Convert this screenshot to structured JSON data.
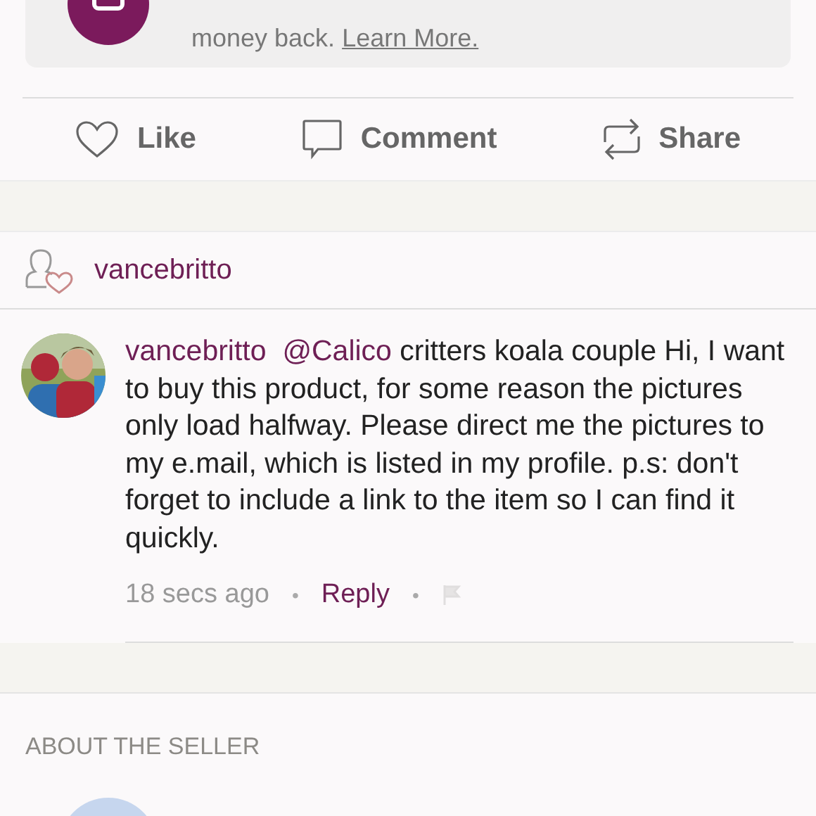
{
  "guarantee": {
    "text": "money back.",
    "link": "Learn More."
  },
  "actions": [
    {
      "kind": "like",
      "label": "Like"
    },
    {
      "kind": "comment",
      "label": "Comment"
    },
    {
      "kind": "share",
      "label": "Share"
    }
  ],
  "likers": {
    "username": "vancebritto"
  },
  "comments": [
    {
      "username": "vancebritto",
      "mention": "@Calico",
      "text": "critters koala couple Hi, I want to buy this product, for some reason the pictures only load halfway. Please direct me the pictures to my e.mail, which is listed in my profile. p.s: don't forget to include a link to the item so I can find it quickly.",
      "time": "18 secs ago",
      "reply": "Reply",
      "separator": "•"
    }
  ],
  "seller": {
    "heading": "ABOUT THE SELLER"
  }
}
